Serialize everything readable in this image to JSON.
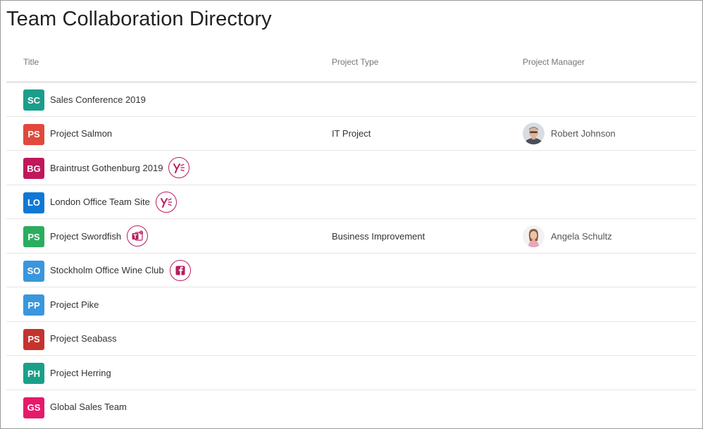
{
  "page": {
    "title": "Team Collaboration Directory"
  },
  "columns": {
    "title": "Title",
    "type": "Project Type",
    "manager": "Project Manager"
  },
  "colors": {
    "badge_accent": "#b81c60"
  },
  "rows": [
    {
      "initials": "SC",
      "tile_color": "#1a9e8a",
      "title": "Sales Conference 2019",
      "badge": null,
      "type": "",
      "manager": ""
    },
    {
      "initials": "PS",
      "tile_color": "#e0493b",
      "title": "Project Salmon",
      "badge": null,
      "type": "IT Project",
      "manager": "Robert Johnson"
    },
    {
      "initials": "BG",
      "tile_color": "#c0185b",
      "title": "Braintrust Gothenburg 2019",
      "badge": "yammer-icon",
      "type": "",
      "manager": ""
    },
    {
      "initials": "LO",
      "tile_color": "#0f78d4",
      "title": "London Office Team Site",
      "badge": "yammer-icon",
      "type": "",
      "manager": ""
    },
    {
      "initials": "PS",
      "tile_color": "#2aad5f",
      "title": "Project Swordfish",
      "badge": "teams-icon",
      "type": "Business Improvement",
      "manager": "Angela Schultz"
    },
    {
      "initials": "SO",
      "tile_color": "#3a96dd",
      "title": "Stockholm Office Wine Club",
      "badge": "facebook-icon",
      "type": "",
      "manager": ""
    },
    {
      "initials": "PP",
      "tile_color": "#3a96dd",
      "title": "Project Pike",
      "badge": null,
      "type": "",
      "manager": ""
    },
    {
      "initials": "PS",
      "tile_color": "#c3342d",
      "title": "Project Seabass",
      "badge": null,
      "type": "",
      "manager": ""
    },
    {
      "initials": "PH",
      "tile_color": "#1aa088",
      "title": "Project Herring",
      "badge": null,
      "type": "",
      "manager": ""
    },
    {
      "initials": "GS",
      "tile_color": "#e6196a",
      "title": "Global Sales Team",
      "badge": null,
      "type": "",
      "manager": ""
    }
  ]
}
